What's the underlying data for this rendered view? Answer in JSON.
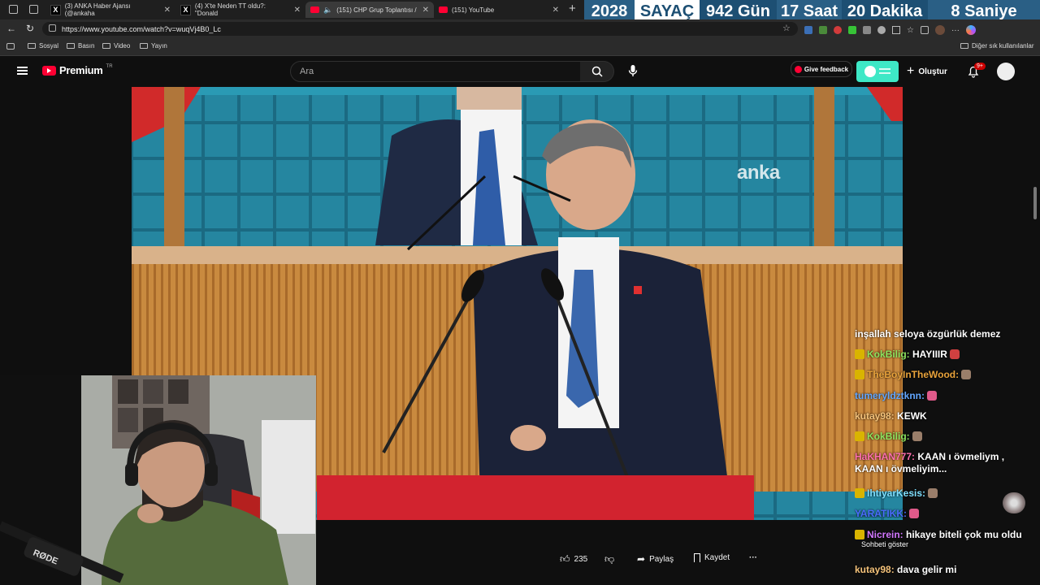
{
  "browser": {
    "tabs": [
      {
        "label": "(3) ANKA Haber Ajansı (@ankaha",
        "favicon": "x-icon"
      },
      {
        "label": "(4) X'te Neden TT oldu?: \"Donald",
        "favicon": "x-icon"
      },
      {
        "label": "(151) CHP Grup Toplantısı / ",
        "favicon": "youtube-icon"
      },
      {
        "label": "(151) YouTube",
        "favicon": "youtube-icon"
      }
    ],
    "new_tab": "+",
    "url": "https://www.youtube.com/watch?v=wuqVj4B0_Lc",
    "bookmarks": [
      "Sosyal",
      "Basın",
      "Video",
      "Yayın"
    ],
    "other_bookmarks": "Diğer sık kullanılanlar"
  },
  "counter": {
    "year": "2028",
    "title": "SAYAÇ",
    "days": "942 Gün",
    "hours": "17 Saat",
    "minutes": "20 Dakika",
    "seconds": "8 Saniye"
  },
  "youtube": {
    "logo_text": "Premium",
    "logo_sup": "TR",
    "search_placeholder": "Ara",
    "feedback_label": "Give feedback",
    "create_label": "Oluştur",
    "notifications_badge": "9+",
    "watermark": "anka",
    "likes": "235",
    "share_label": "Paylaş",
    "save_label": "Kaydet",
    "more_label": "···",
    "show_chat": "Sohbeti göster"
  },
  "chat": [
    {
      "user": "",
      "text": "inşallah seloya özgürlük demez",
      "user_color": "#ffffff",
      "badge": false,
      "emote": ""
    },
    {
      "user": "KokBilig:",
      "text": " HAYIIIR",
      "user_color": "#8ee55f",
      "badge": true,
      "emote": "#d04040"
    },
    {
      "user": "TheBoyInTheWood:",
      "text": "",
      "user_color": "#e9a33b",
      "badge": true,
      "emote": "#9a7e6a"
    },
    {
      "user": "tumeryldztknn:",
      "text": "",
      "user_color": "#63a7ff",
      "badge": false,
      "emote": "#e05a8a"
    },
    {
      "user": "kutay98:",
      "text": " KEWK",
      "user_color": "#f4c27a",
      "badge": false,
      "emote": ""
    },
    {
      "user": "KokBilig:",
      "text": "",
      "user_color": "#8ee55f",
      "badge": true,
      "emote": "#9a7e6a"
    },
    {
      "user": "HaKHAN777:",
      "text": " KAAN ı övmeliym , KAAN ı övmeliyim...",
      "user_color": "#ff6fae",
      "badge": false,
      "emote": ""
    },
    {
      "user": "IhtiyarKesis:",
      "text": "",
      "user_color": "#7fe0ff",
      "badge": true,
      "emote": "#9a7e6a"
    },
    {
      "user": "YARATIKK:",
      "text": "",
      "user_color": "#4a6dff",
      "badge": false,
      "emote": "#e05a8a"
    },
    {
      "user": "Nicrein:",
      "text": " hikaye biteli çok mu oldu",
      "user_color": "#d277ff",
      "badge": true,
      "emote": ""
    },
    {
      "user": "kutay98:",
      "text": " dava gelir mi",
      "user_color": "#f4c27a",
      "badge": false,
      "emote": ""
    }
  ],
  "webcam": {
    "mic_brand": "RØDE"
  },
  "colors": {
    "counter_dark": "#1d4f73",
    "counter_light": "#ffffff",
    "yt_red": "#ff0033",
    "feedback_toggle": "#3ee8c6"
  }
}
